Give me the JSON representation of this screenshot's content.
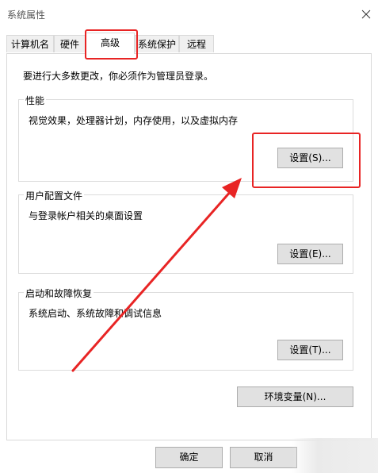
{
  "window": {
    "title": "系统属性"
  },
  "tabs": [
    {
      "label": "计算机名",
      "active": false
    },
    {
      "label": "硬件",
      "active": false
    },
    {
      "label": "高级",
      "active": true
    },
    {
      "label": "系统保护",
      "active": false
    },
    {
      "label": "远程",
      "active": false
    }
  ],
  "advanced": {
    "admin_note": "要进行大多数更改，你必须作为管理员登录。",
    "performance": {
      "title": "性能",
      "description": "视觉效果，处理器计划，内存使用，以及虚拟内存",
      "button": "设置(S)..."
    },
    "user_profiles": {
      "title": "用户配置文件",
      "description": "与登录帐户相关的桌面设置",
      "button": "设置(E)..."
    },
    "startup_recovery": {
      "title": "启动和故障恢复",
      "description": "系统启动、系统故障和调试信息",
      "button": "设置(T)..."
    },
    "env_button": "环境变量(N)..."
  },
  "footer": {
    "ok": "确定",
    "cancel": "取消"
  },
  "annotations": {
    "highlight_color": "#e82424"
  }
}
